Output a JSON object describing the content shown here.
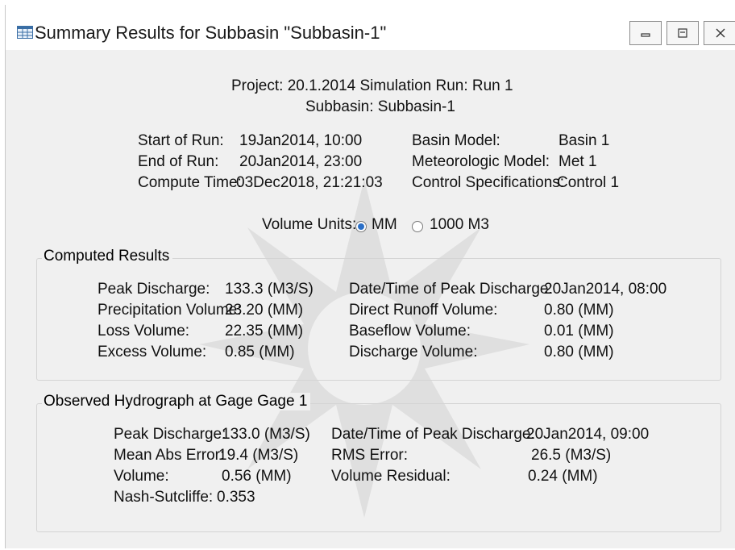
{
  "window": {
    "title": "Summary Results for Subbasin \"Subbasin-1\""
  },
  "header": {
    "project_line": "Project: 20.1.2014    Simulation Run: Run 1",
    "subbasin_line": "Subbasin: Subbasin-1"
  },
  "run_info": {
    "start_label": "Start of Run:",
    "start_value": "19Jan2014, 10:00",
    "end_label": "End of Run:",
    "end_value": "20Jan2014, 23:00",
    "compute_label": "Compute Time:",
    "compute_value": "03Dec2018, 21:21:03",
    "basin_label": "Basin Model:",
    "basin_value": "Basin 1",
    "met_label": "Meteorologic Model:",
    "met_value": "Met 1",
    "control_label": "Control Specifications:",
    "control_value": "Control 1"
  },
  "volume_units": {
    "label": "Volume Units:",
    "options": [
      "MM",
      "1000 M3"
    ],
    "selected": "MM"
  },
  "computed": {
    "title": "Computed Results",
    "peak_label": "Peak Discharge:",
    "peak_value": "133.3 (M3/S)",
    "precip_label": "Precipitation Volume:",
    "precip_value": "23.20 (MM)",
    "loss_label": "Loss Volume:",
    "loss_value": "22.35 (MM)",
    "excess_label": "Excess Volume:",
    "excess_value": "0.85 (MM)",
    "peak_time_label": "Date/Time of Peak Discharge:",
    "peak_time_value": "20Jan2014, 08:00",
    "direct_label": "Direct Runoff Volume:",
    "direct_value": "0.80 (MM)",
    "baseflow_label": "Baseflow Volume:",
    "baseflow_value": "0.01 (MM)",
    "discharge_label": "Discharge Volume:",
    "discharge_value": "0.80 (MM)"
  },
  "observed": {
    "title": "Observed Hydrograph at Gage Gage 1",
    "peak_label": "Peak Discharge:",
    "peak_value": "133.0 (M3/S)",
    "mae_label": "Mean Abs Error:",
    "mae_value": "19.4 (M3/S)",
    "volume_label": "Volume:",
    "volume_value": "0.56 (MM)",
    "nash_label": "Nash-Sutcliffe:",
    "nash_value": "0.353",
    "peak_time_label": "Date/Time of Peak Discharge:",
    "peak_time_value": "20Jan2014, 09:00",
    "rms_label": "RMS Error:",
    "rms_value": "26.5 (M3/S)",
    "residual_label": "Volume Residual:",
    "residual_value": "0.24 (MM)"
  }
}
